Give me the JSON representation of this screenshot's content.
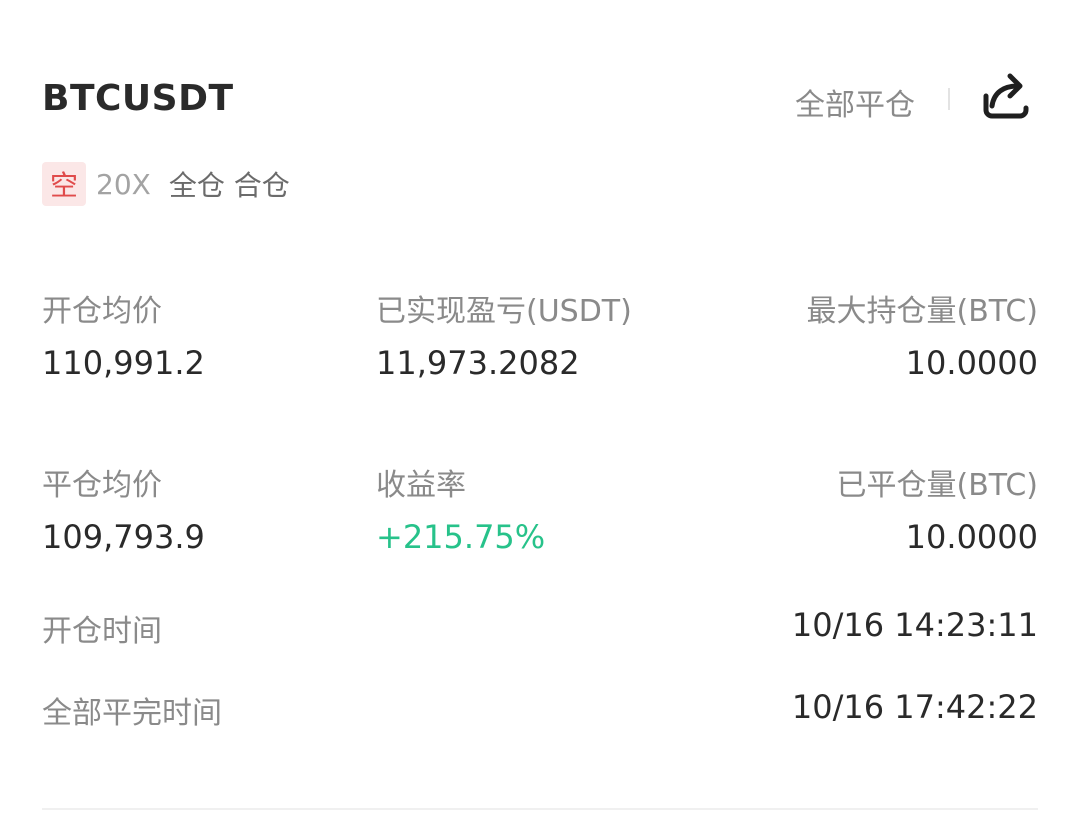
{
  "header": {
    "symbol": "BTCUSDT",
    "close_all_label": "全部平仓",
    "share_icon": "share-icon"
  },
  "tags": {
    "direction": "空",
    "leverage": "20X",
    "margin_mode": "全仓 合仓"
  },
  "stats": {
    "row1": [
      {
        "label": "开仓均价",
        "value": "110,991.2"
      },
      {
        "label": "已实现盈亏(USDT)",
        "value": "11,973.2082"
      },
      {
        "label": "最大持仓量(BTC)",
        "value": "10.0000"
      }
    ],
    "row2": [
      {
        "label": "平仓均价",
        "value": "109,793.9"
      },
      {
        "label": "收益率",
        "value": "+215.75%"
      },
      {
        "label": "已平仓量(BTC)",
        "value": "10.0000"
      }
    ],
    "open_time": {
      "label": "开仓时间",
      "value": "10/16 14:23:11"
    },
    "close_time": {
      "label": "全部平完时间",
      "value": "10/16 17:42:22"
    }
  },
  "colors": {
    "profit": "#27c28a",
    "short": "#e04b4b",
    "muted": "#8a8a8a"
  }
}
